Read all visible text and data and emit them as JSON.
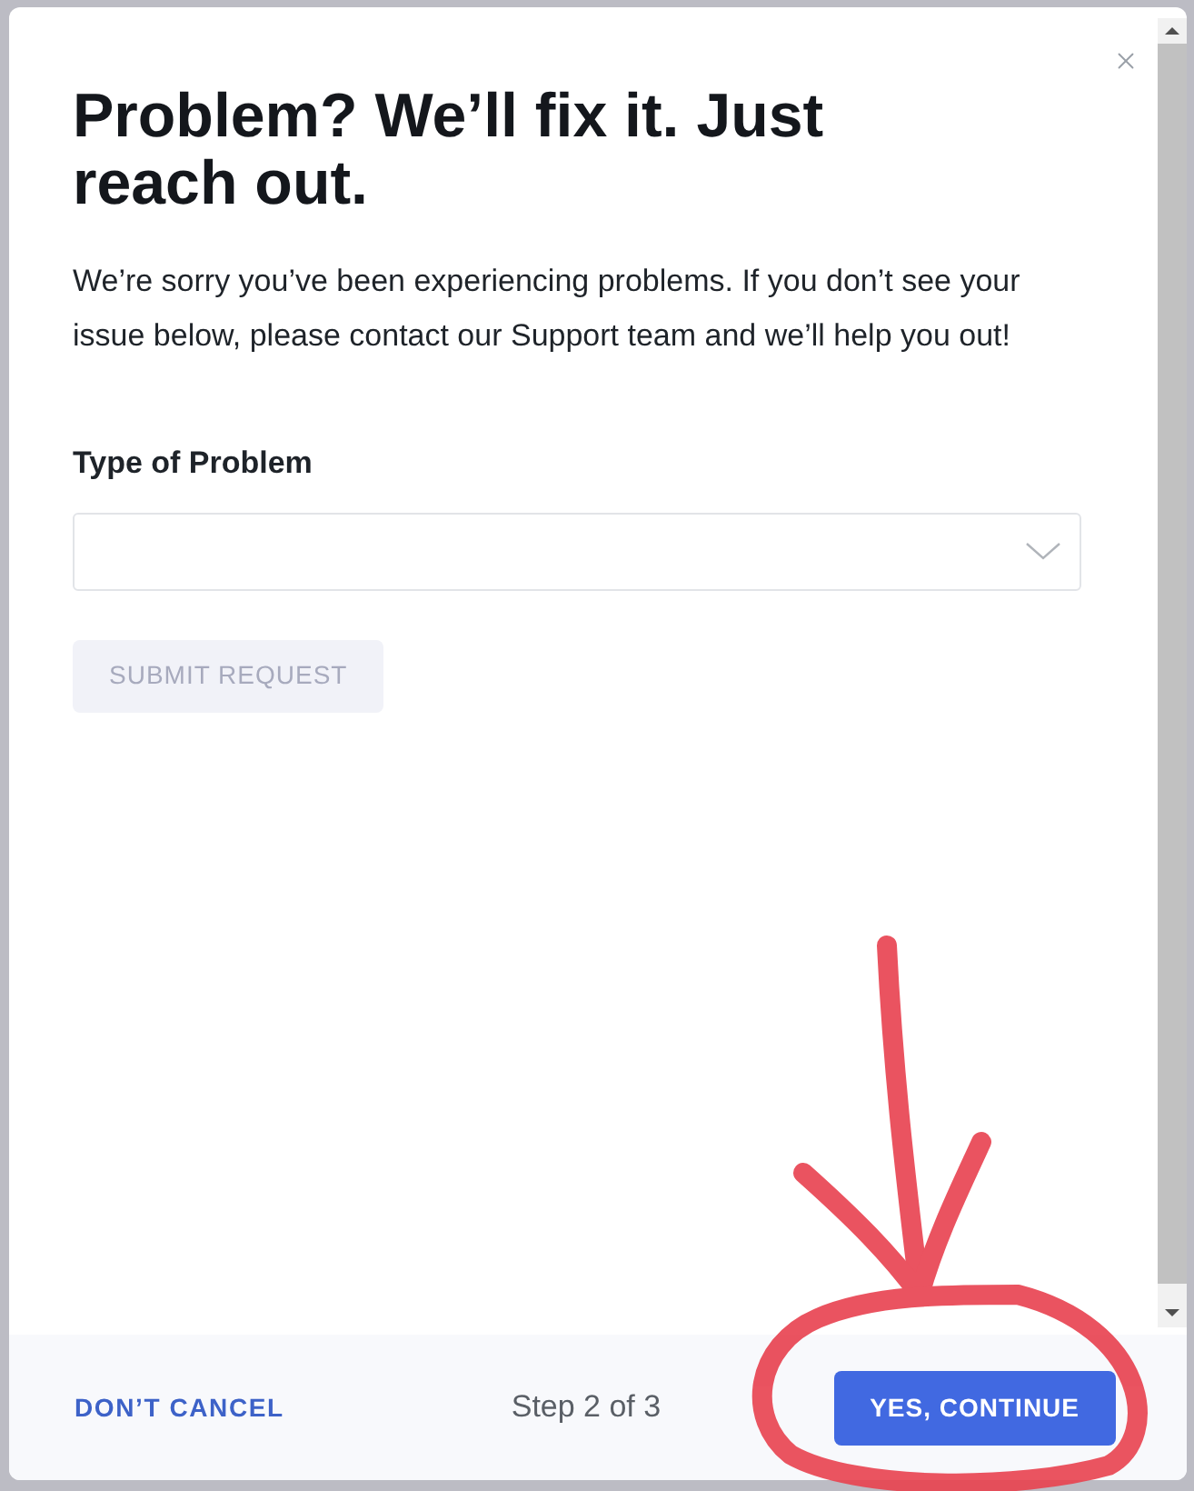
{
  "dialog": {
    "title": "Problem? We’ll fix it. Just reach out.",
    "message": "We’re sorry you’ve been experiencing problems. If you don’t see your issue below, please contact our Support team and we’ll help you out!",
    "field": {
      "label": "Type of Problem"
    },
    "submit": {
      "label": "SUBMIT REQUEST",
      "disabled": true
    }
  },
  "footer": {
    "cancel": "DON’T CANCEL",
    "step": "Step 2 of 3",
    "continue": "YES, CONTINUE"
  }
}
